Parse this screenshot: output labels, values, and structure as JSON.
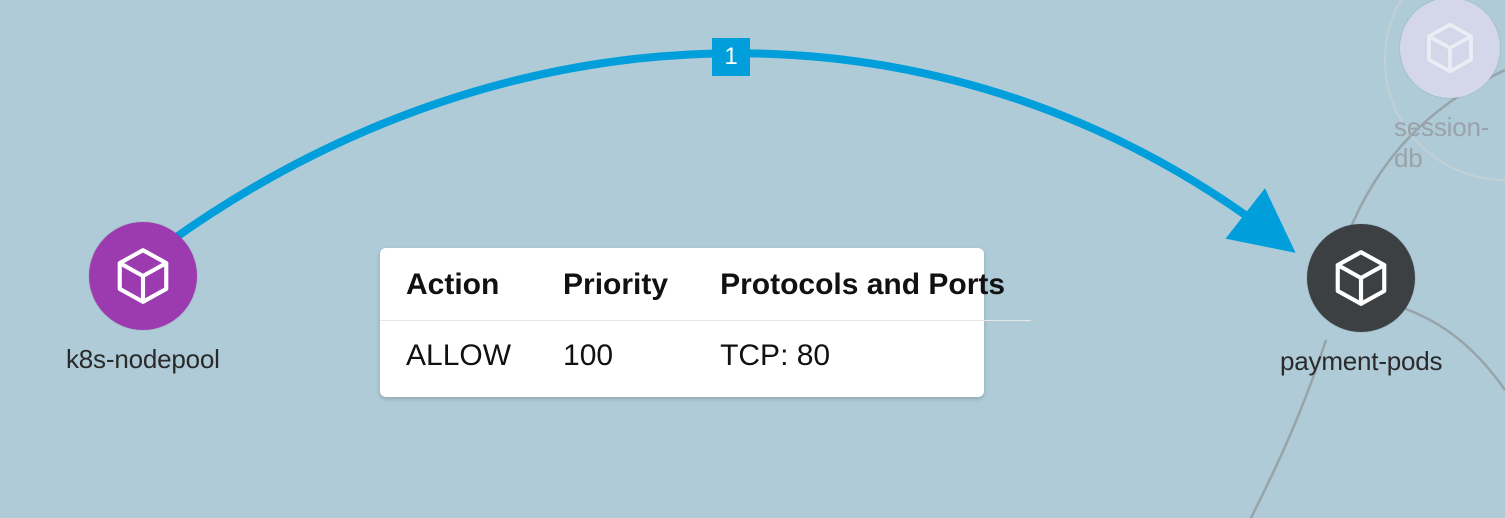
{
  "nodes": {
    "source": {
      "label": "k8s-nodepool",
      "color": "#9c3bb0"
    },
    "target": {
      "label": "payment-pods",
      "color": "#3c4043"
    },
    "ghost": {
      "label": "session-db",
      "color": "#d4d7ea"
    }
  },
  "edge": {
    "badge": "1",
    "stroke": "#009fdb"
  },
  "rule": {
    "headers": {
      "action": "Action",
      "priority": "Priority",
      "protocols": "Protocols and Ports"
    },
    "row": {
      "action": "ALLOW",
      "priority": "100",
      "protocols": "TCP: 80"
    }
  }
}
